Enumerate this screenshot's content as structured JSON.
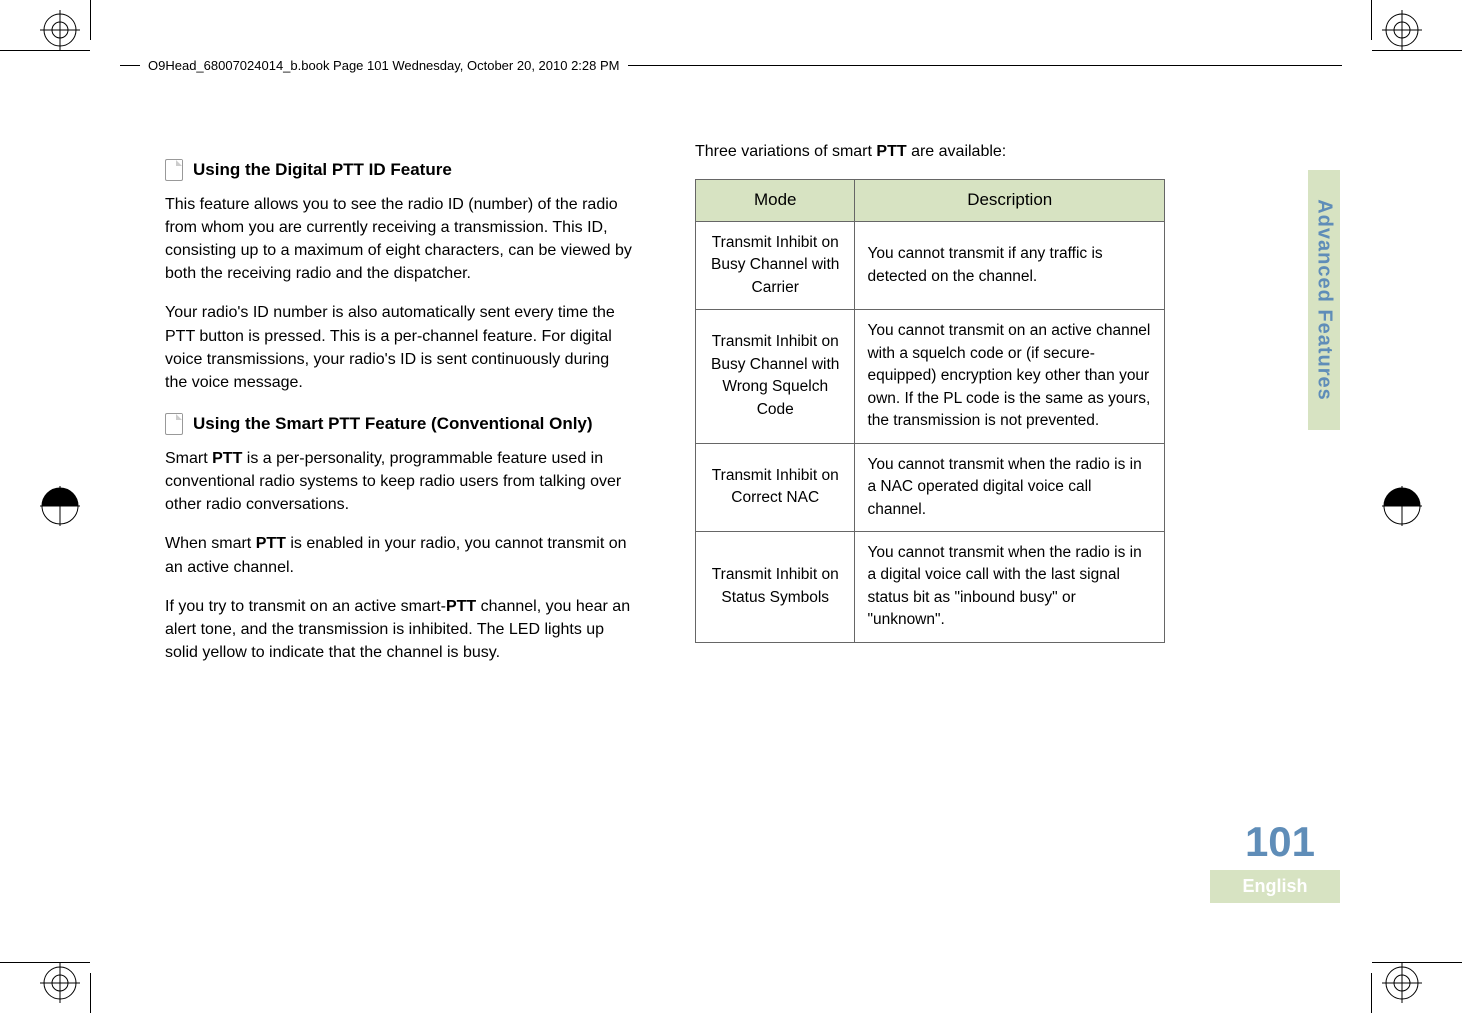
{
  "header": {
    "text": "O9Head_68007024014_b.book  Page 101  Wednesday, October 20, 2010  2:28 PM"
  },
  "left": {
    "section1_title": "Using the Digital PTT ID Feature",
    "p1": "This feature allows you to see the radio ID (number) of the radio from whom you are currently receiving a transmission. This ID, consisting up to a maximum of eight characters, can be viewed by both the receiving radio and the dispatcher.",
    "p2": "Your radio's ID number is also automatically sent every time the PTT button is pressed. This is a per-channel feature. For digital voice transmissions, your radio's ID is sent continuously during the voice message.",
    "section2_title": "Using the Smart PTT Feature (Conventional Only)",
    "p3a": "Smart ",
    "p3b": "PTT",
    "p3c": " is a per-personality, programmable feature used in conventional radio systems to keep radio users from talking over other radio conversations.",
    "p4a": "When smart ",
    "p4b": "PTT",
    "p4c": " is enabled in your radio, you cannot transmit on an active channel.",
    "p5a": "If you try to transmit on an active smart-",
    "p5b": "PTT",
    "p5c": " channel, you hear an alert tone, and the transmission is inhibited. The LED lights up solid yellow to indicate that the channel is busy."
  },
  "right": {
    "intro_a": "Three variations of smart ",
    "intro_b": "PTT",
    "intro_c": " are available:",
    "table": {
      "head_mode": "Mode",
      "head_desc": "Description",
      "rows": [
        {
          "mode": "Transmit Inhibit on Busy Channel with Carrier",
          "desc": "You cannot transmit if any traffic is detected on the channel."
        },
        {
          "mode": "Transmit Inhibit on Busy Channel with Wrong Squelch Code",
          "desc": "You cannot transmit on an active channel with a squelch code or (if secure-equipped) encryption key other than your own. If the PL code is the same as yours, the transmission is not prevented."
        },
        {
          "mode": "Transmit Inhibit on Correct NAC",
          "desc": "You cannot transmit when the radio is in a NAC operated digital voice call channel."
        },
        {
          "mode": "Transmit Inhibit on Status Symbols",
          "desc": "You cannot transmit when the radio is in a digital voice call with the last signal status bit as \"inbound busy\" or \"unknown\"."
        }
      ]
    }
  },
  "side_tab": "Advanced Features",
  "page_number": "101",
  "language": "English"
}
